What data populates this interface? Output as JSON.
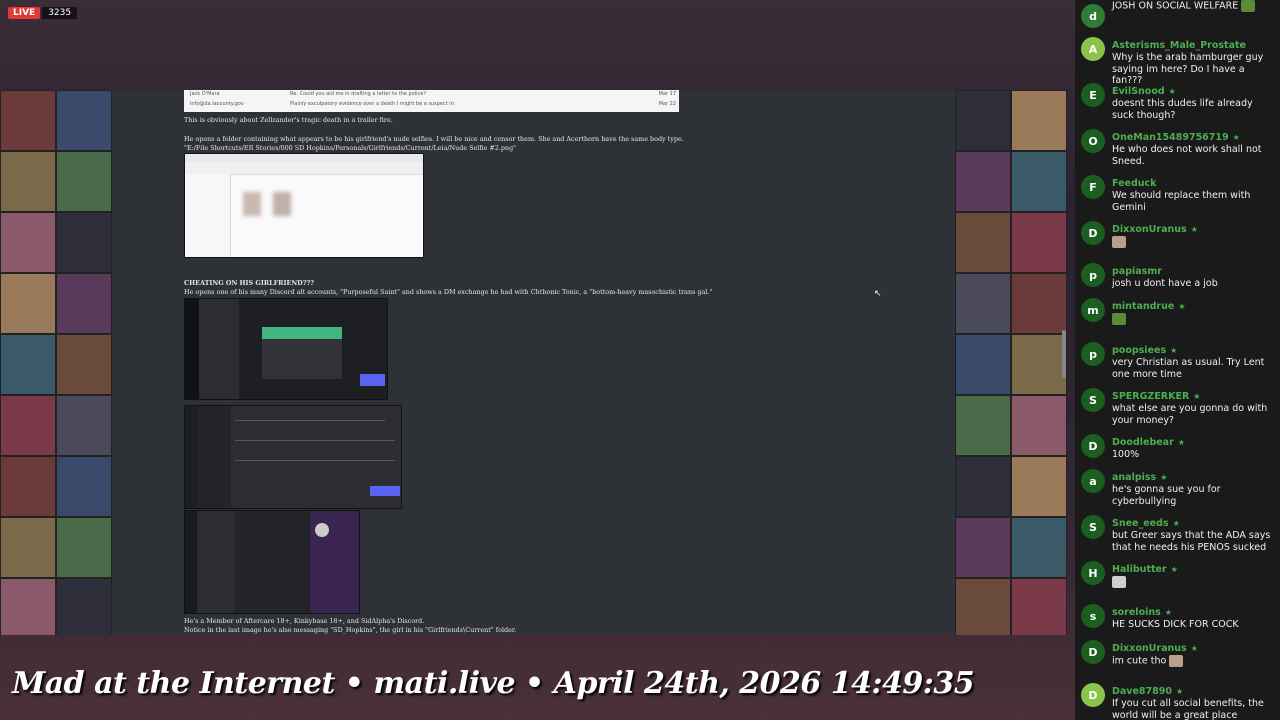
{
  "stream": {
    "live_label": "LIVE",
    "viewer_count": "3235",
    "banner": "Mad at the Internet • mati.live • April 24th, 2026 14:49:35"
  },
  "document": {
    "emails": [
      {
        "from": "Jack O'Mara",
        "subject": "Re: Could you aid me in drafting a letter to the police?",
        "date": "Mar 17"
      },
      {
        "from": "info@da.lacounty.gov",
        "subject": "Plainly exculpatory evidence over a death I might be a suspect in",
        "date": "Mar 22"
      }
    ],
    "para1": "This is obviously about Zellzander's tragic death in a trailer fire.",
    "para2": "He opens a folder containing what appears to be his girlfriend's nude selfies. I will be nice and censor them. She and Acerthorn have the same body type.",
    "path": "\"E:/File Shortcuts/ER Stories/000 SD Hopkins/Personals/Girlfriends/Current/Leia/Nude Selfie #2.png\"",
    "heading": "CHEATING ON HIS GIRLFRIEND???",
    "para3": "He opens one of his many Discord alt accounts, \"Purposeful Saint\" and shows a DM exchange he had with Chthonic Tonic, a \"bottom-heavy masochistic trans gal.\"",
    "para4": "He's a Member of Aftercare 18+, Kinkybase 18+, and SidAlpha's Discord.",
    "para5": "Notice in the last image he's also messaging \"SD_Hopkins\", the girl in his \"Girlfriends\\Current\" folder."
  },
  "chat": [
    {
      "user": "",
      "avatar": "d",
      "color": "#2e7d32",
      "text": "JOSH ON SOCIAL WELFARE",
      "emote": "frog"
    },
    {
      "user": "Asterisms_Male_Prostate",
      "avatar": "A",
      "color": "#8bc34a",
      "text": "Why is the arab hamburger guy saying im here? Do I have a fan???",
      "star": false
    },
    {
      "user": "EvilSnood",
      "avatar": "E",
      "color": "#1b5e20",
      "text": "doesnt this dudes life already suck though?",
      "star": true
    },
    {
      "user": "OneMan15489756719",
      "avatar": "O",
      "color": "#1b5e20",
      "text": "He who does not work shall not Sneed.",
      "star": true
    },
    {
      "user": "Feeduck",
      "avatar": "F",
      "color": "#1b5e20",
      "text": "We should replace them with Gemini",
      "star": false
    },
    {
      "user": "DixxonUranus",
      "avatar": "D",
      "color": "#1b5e20",
      "text": "",
      "star": true,
      "emote": "cat"
    },
    {
      "user": "papiasmr",
      "avatar": "p",
      "color": "#1b5e20",
      "text": "josh u dont have a job",
      "star": false
    },
    {
      "user": "mintandrue",
      "avatar": "m",
      "color": "#1b5e20",
      "text": "",
      "star": true,
      "emote": "frog"
    },
    {
      "user": "poopsiees",
      "avatar": "p",
      "color": "#1b5e20",
      "text": "very Christian as usual. Try Lent one more time",
      "star": true
    },
    {
      "user": "SPERGZERKER",
      "avatar": "S",
      "color": "#1b5e20",
      "text": "what else are you gonna do with your money?",
      "star": true
    },
    {
      "user": "Doodlebear",
      "avatar": "D",
      "color": "#1b5e20",
      "text": "100%",
      "star": true
    },
    {
      "user": "analpiss",
      "avatar": "a",
      "color": "#1b5e20",
      "text": "he's gonna sue you for cyberbullying",
      "star": true
    },
    {
      "user": "Snee_eeds",
      "avatar": "S",
      "color": "#1b5e20",
      "text": "but Greer says that the ADA says that he needs his PENOS sucked",
      "star": true
    },
    {
      "user": "Halibutter",
      "avatar": "H",
      "color": "#1b5e20",
      "text": "",
      "star": true,
      "emote": "pic"
    },
    {
      "user": "soreloins",
      "avatar": "s",
      "color": "#1b5e20",
      "text": "HE SUCKS DICK FOR COCK",
      "star": true
    },
    {
      "user": "DixxonUranus",
      "avatar": "D",
      "color": "#1b5e20",
      "text": "im cute tho",
      "star": true,
      "emote": "cat"
    },
    {
      "user": "Dave87890",
      "avatar": "D",
      "color": "#8bc34a",
      "text": "If you cut all social benefits, the world will be a great place",
      "star": true
    }
  ]
}
